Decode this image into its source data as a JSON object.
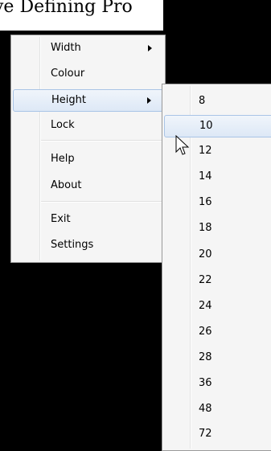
{
  "window": {
    "title_fragment": "ve Defining Pro"
  },
  "main_menu": {
    "items": [
      {
        "label": "Width"
      },
      {
        "label": "Colour"
      },
      {
        "label": "Height"
      },
      {
        "label": "Lock"
      },
      {
        "label": "Help"
      },
      {
        "label": "About"
      },
      {
        "label": "Exit"
      },
      {
        "label": "Settings"
      }
    ]
  },
  "height_submenu": {
    "items": [
      "8",
      "10",
      "12",
      "14",
      "16",
      "18",
      "20",
      "22",
      "24",
      "26",
      "28",
      "36",
      "48",
      "72"
    ]
  }
}
